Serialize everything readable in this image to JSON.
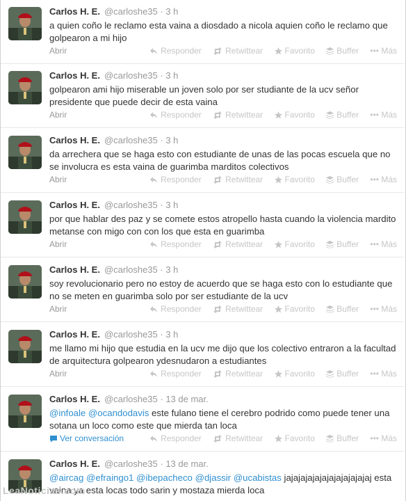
{
  "tweets": [
    {
      "name": "Carlos H. E.",
      "handle": "@carloshe35",
      "time": "3 h",
      "text": "a quien coño le reclamo esta vaina a diosdado a nicola aquien coño le reclamo que golpearon a mi hijo",
      "footer_link": "Abrir"
    },
    {
      "name": "Carlos H. E.",
      "handle": "@carloshe35",
      "time": "3 h",
      "text": "golpearon ami hijo miserable un joven solo por ser studiante de la ucv señor presidente que puede decir de esta vaina",
      "footer_link": "Abrir"
    },
    {
      "name": "Carlos H. E.",
      "handle": "@carloshe35",
      "time": "3 h",
      "text": "da arrechera que se haga esto con estudiante  de unas de las pocas escuela que no se involucra es esta vaina de guarimba marditos colectivos",
      "footer_link": "Abrir"
    },
    {
      "name": "Carlos H. E.",
      "handle": "@carloshe35",
      "time": "3 h",
      "text": "por que hablar des paz y se comete estos atropello hasta cuando la violencia mardito metanse con migo con con los que esta en guarimba",
      "footer_link": "Abrir"
    },
    {
      "name": "Carlos H. E.",
      "handle": "@carloshe35",
      "time": "3 h",
      "text": "soy revolucionario pero no estoy de acuerdo que se haga esto con lo estudiante que no se meten en guarimba solo por ser estudiante de la ucv",
      "footer_link": "Abrir"
    },
    {
      "name": "Carlos H. E.",
      "handle": "@carloshe35",
      "time": "3 h",
      "text": "me llamo mi hijo que estudia en la ucv me dijo que los colectivo entraron a la facultad de arquitectura golpearon ydesnudaron a estudiantes",
      "footer_link": "Abrir"
    },
    {
      "name": "Carlos H. E.",
      "handle": "@carloshe35",
      "time": "13 de mar.",
      "mentions": [
        "@infoale",
        "@ocandodavis"
      ],
      "text": " este fulano tiene el cerebro podrido como puede tener una sotana un loco como este que mierda tan loca",
      "footer_link": "Ver conversación"
    },
    {
      "name": "Carlos H. E.",
      "handle": "@carloshe35",
      "time": "13 de mar.",
      "mentions": [
        "@aircag",
        "@efraingo1",
        "@ibepacheco",
        "@djassir",
        "@ucabistas"
      ],
      "text": " jajajajajajajajajajajajaj esta vaina ya esta locas todo sarin y mostaza mierda loca",
      "footer_link": ""
    }
  ],
  "actions": {
    "reply": "Responder",
    "retweet": "Retwittear",
    "favorite": "Favorito",
    "buffer": "Buffer",
    "more": "Más"
  },
  "watermark": "LeaNoticias.com"
}
